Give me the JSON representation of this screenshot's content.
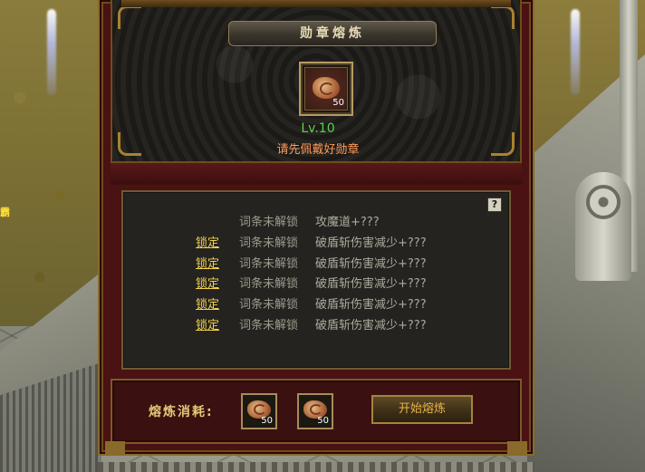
{
  "panel": {
    "title": "勋章熔炼",
    "medal_slot": {
      "icon": "medal-icon",
      "quantity": "50"
    },
    "level": "Lv.10",
    "hint": "请先佩戴好勋章",
    "help_button": "?",
    "attributes": [
      {
        "lock": "",
        "status": "词条未解锁",
        "attr": "攻魔道+???"
      },
      {
        "lock": "锁定",
        "status": "词条未解锁",
        "attr": "破盾斩伤害减少+???"
      },
      {
        "lock": "锁定",
        "status": "词条未解锁",
        "attr": "破盾斩伤害减少+???"
      },
      {
        "lock": "锁定",
        "status": "词条未解锁",
        "attr": "破盾斩伤害减少+???"
      },
      {
        "lock": "锁定",
        "status": "词条未解锁",
        "attr": "破盾斩伤害减少+???"
      },
      {
        "lock": "锁定",
        "status": "词条未解锁",
        "attr": "破盾斩伤害减少+???"
      }
    ],
    "cost": {
      "label": "熔炼消耗:",
      "items": [
        {
          "icon": "medal-icon",
          "quantity": "50"
        },
        {
          "icon": "medal-icon",
          "quantity": "50"
        }
      ],
      "start_button": "开始熔炼"
    }
  },
  "colors": {
    "level_green": "#58d44a",
    "hint_orange": "#ff9a5a",
    "lock_yellow": "#f5d24c",
    "frame_gold": "#a9822f"
  }
}
